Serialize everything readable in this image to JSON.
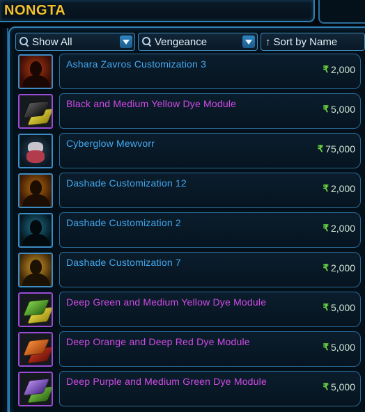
{
  "window": {
    "title": "NONGTA"
  },
  "filters": {
    "show": "Show All",
    "server": "Vengeance",
    "sort": "Sort by Name"
  },
  "colors": {
    "accent": "#2f80b5",
    "title_gold": "#f2c12e",
    "name_blue": "#43a8ef",
    "name_purple": "#d24be8",
    "credit_green": "#6ddc41"
  },
  "items": [
    {
      "name": "Ashara Zavros Customization 3",
      "price": "2,000",
      "rarity": "blue",
      "icon": "portrait-ashara-icon"
    },
    {
      "name": "Black and Medium Yellow Dye Module",
      "price": "5,000",
      "rarity": "purple",
      "icon": "dye-black-yellow-icon"
    },
    {
      "name": "Cyberglow Mewvorr",
      "price": "75,000",
      "rarity": "blue",
      "icon": "mewvorr-pet-icon"
    },
    {
      "name": "Dashade Customization 12",
      "price": "2,000",
      "rarity": "blue",
      "icon": "portrait-dashade-12-icon"
    },
    {
      "name": "Dashade Customization 2",
      "price": "2,000",
      "rarity": "blue",
      "icon": "portrait-dashade-2-icon"
    },
    {
      "name": "Dashade Customization 7",
      "price": "2,000",
      "rarity": "blue",
      "icon": "portrait-dashade-7-icon"
    },
    {
      "name": "Deep Green and Medium Yellow Dye Module",
      "price": "5,000",
      "rarity": "purple",
      "icon": "dye-green-yellow-icon"
    },
    {
      "name": "Deep Orange and Deep Red Dye Module",
      "price": "5,000",
      "rarity": "purple",
      "icon": "dye-orange-red-icon"
    },
    {
      "name": "Deep Purple and Medium Green Dye Module",
      "price": "5,000",
      "rarity": "purple",
      "icon": "dye-purple-green-icon"
    }
  ]
}
